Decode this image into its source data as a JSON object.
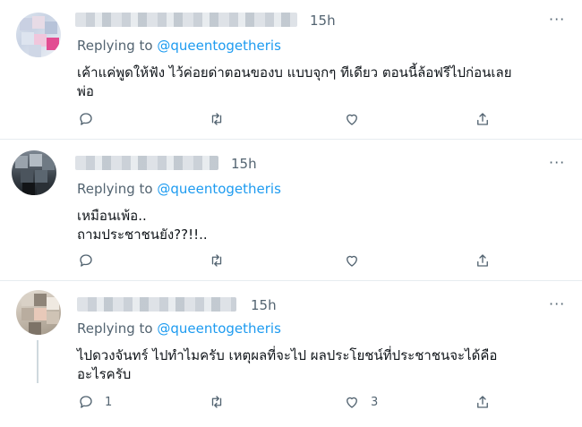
{
  "tweets": [
    {
      "time": "15h",
      "reply_prefix": "Replying to ",
      "reply_handle": "@queentogetheris",
      "text_lines": [
        "เค้าแค่พูดให้ฟัง ไว้ค่อยด่าตอนของบ แบบจุกๆ ทีเดียว ตอนนี้ล้อฟรีไปก่อนเลย",
        "พ่อ"
      ],
      "actions": {
        "reply_count": "",
        "retweet_count": "",
        "like_count": ""
      }
    },
    {
      "time": "15h",
      "reply_prefix": "Replying to ",
      "reply_handle": "@queentogetheris",
      "text_lines": [
        "เหมือนเพ้อ..",
        "ถามประชาชนยัง??!!.."
      ],
      "actions": {
        "reply_count": "",
        "retweet_count": "",
        "like_count": ""
      }
    },
    {
      "time": "15h",
      "reply_prefix": "Replying to ",
      "reply_handle": "@queentogetheris",
      "text_lines": [
        "ไปดวงจันทร์ ไปทำไมครับ เหตุผลที่จะไป ผลประโยชน์ที่ประชาชนจะได้คือ",
        "อะไรครับ"
      ],
      "actions": {
        "reply_count": "1",
        "retweet_count": "",
        "like_count": "3"
      }
    }
  ],
  "more_label": "···",
  "icons": {
    "reply": "reply-icon",
    "retweet": "retweet-icon",
    "like": "like-icon",
    "share": "share-icon",
    "more": "more-icon"
  },
  "colors": {
    "handle": "#1d9bf0",
    "secondary_text": "#536471",
    "divider": "#e6ecf0"
  }
}
